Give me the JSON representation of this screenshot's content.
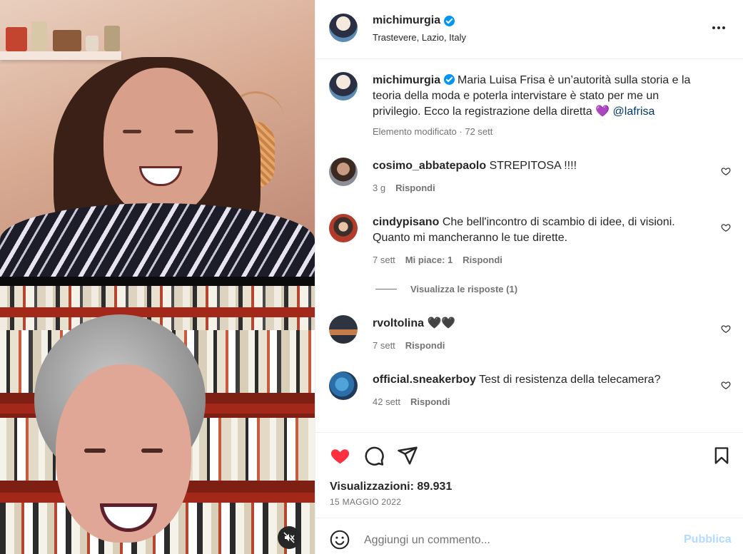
{
  "post": {
    "username": "michimurgia",
    "location": "Trastevere, Lazio, Italy",
    "caption": "Maria Luisa Frisa è un’autorità sulla storia e la teoria della moda e poterla intervistare è stato per me un privilegio. Ecco la registrazione della diretta 💜",
    "caption_mention": "@lafrisa",
    "caption_meta": "Elemento modificato · 72 sett"
  },
  "comments": [
    {
      "username": "cosimo_abbatepaolo",
      "text": "STREPITOSA !!!!",
      "time": "3 g",
      "likes": "",
      "reply": "Rispondi"
    },
    {
      "username": "cindypisano",
      "text": "Che bell'incontro di scambio di idee, di visioni. Quanto mi mancheranno le tue dirette.",
      "time": "7 sett",
      "likes": "Mi piace: 1",
      "reply": "Rispondi",
      "view_replies": "Visualizza le risposte (1)"
    },
    {
      "username": "rvoltolina",
      "text": "🖤🖤",
      "time": "7 sett",
      "likes": "",
      "reply": "Rispondi"
    },
    {
      "username": "official.sneakerboy",
      "text": "Test di resistenza della telecamera?",
      "time": "42 sett",
      "likes": "",
      "reply": "Rispondi"
    }
  ],
  "stats": {
    "views": "Visualizzazioni: 89.931",
    "date": "15 MAGGIO 2022"
  },
  "composer": {
    "placeholder": "Aggiungi un commento...",
    "publish": "Pubblica"
  },
  "colors": {
    "liked_heart": "#ff3040",
    "link": "#00376b",
    "publish_disabled": "#b3dbff",
    "verified": "#0095f6"
  },
  "icons": [
    "verified-badge-icon",
    "more-options-icon",
    "heart-icon",
    "comment-icon",
    "share-icon",
    "save-icon",
    "emoji-icon",
    "mute-icon"
  ]
}
